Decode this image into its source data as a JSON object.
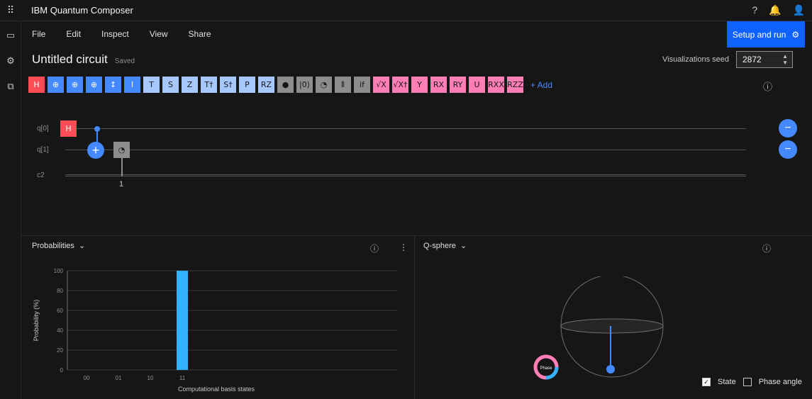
{
  "app": {
    "title": "IBM Quantum Composer"
  },
  "menu": {
    "file": "File",
    "edit": "Edit",
    "inspect": "Inspect",
    "view": "View",
    "share": "Share"
  },
  "run_button": "Setup and run",
  "circuit": {
    "title": "Untitled circuit",
    "status": "Saved"
  },
  "seed": {
    "label": "Visualizations seed",
    "value": "2872"
  },
  "palette": {
    "gates": [
      {
        "label": "H",
        "kind": "red"
      },
      {
        "label": "⊕",
        "kind": "blue"
      },
      {
        "label": "⊕",
        "kind": "blue"
      },
      {
        "label": "⊕",
        "kind": "blue"
      },
      {
        "label": "↕",
        "kind": "blue"
      },
      {
        "label": "I",
        "kind": "blue"
      },
      {
        "label": "T",
        "kind": "lblue"
      },
      {
        "label": "S",
        "kind": "lblue"
      },
      {
        "label": "Z",
        "kind": "lblue"
      },
      {
        "label": "T†",
        "kind": "lblue"
      },
      {
        "label": "S†",
        "kind": "lblue"
      },
      {
        "label": "P",
        "kind": "lblue"
      },
      {
        "label": "RZ",
        "kind": "lblue"
      },
      {
        "label": "●",
        "kind": "gray"
      },
      {
        "label": "|0⟩",
        "kind": "gray"
      },
      {
        "label": "◔",
        "kind": "gray"
      },
      {
        "label": "⦀",
        "kind": "gray"
      },
      {
        "label": "if",
        "kind": "gray"
      },
      {
        "label": "√X",
        "kind": "pink"
      },
      {
        "label": "√X†",
        "kind": "pink"
      },
      {
        "label": "Y",
        "kind": "pink"
      },
      {
        "label": "RX",
        "kind": "pink"
      },
      {
        "label": "RY",
        "kind": "pink"
      },
      {
        "label": "U",
        "kind": "pink"
      },
      {
        "label": "RXX",
        "kind": "pink"
      },
      {
        "label": "RZZ",
        "kind": "pink"
      }
    ],
    "add_label": "+ Add"
  },
  "wires": {
    "q0": "q[0]",
    "q1": "q[1]",
    "c": "c2"
  },
  "measure_index": "1",
  "probabilities": {
    "title": "Probabilities"
  },
  "qsphere": {
    "title": "Q-sphere",
    "state_label": "State",
    "phase_label": "Phase angle",
    "phase_wheel": "Phase"
  },
  "chart_data": {
    "type": "bar",
    "categories": [
      "00",
      "01",
      "10",
      "11"
    ],
    "values": [
      0,
      0,
      0,
      100
    ],
    "xlabel": "Computational basis states",
    "ylabel": "Probability (%)",
    "ylim": [
      0,
      100
    ],
    "yticks": [
      "0",
      "20",
      "40",
      "60",
      "80",
      "100"
    ],
    "grid": true
  },
  "colors": {
    "accent": "#0f62fe",
    "bar": "#33b1ff"
  }
}
